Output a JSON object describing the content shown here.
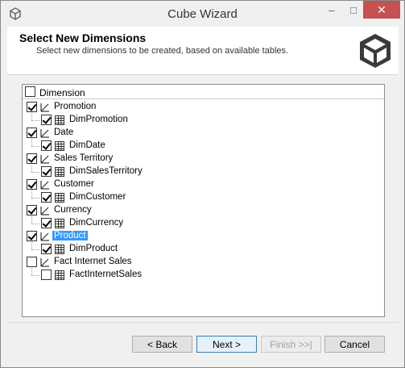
{
  "window": {
    "title": "Cube Wizard",
    "minimize_glyph": "–",
    "maximize_glyph": "□",
    "close_glyph": "✕"
  },
  "header": {
    "title": "Select New Dimensions",
    "subtitle": "Select new dimensions to be created, based on available tables."
  },
  "tree": {
    "column_header": "Dimension",
    "header_checked": false,
    "nodes": [
      {
        "dimension": "Promotion",
        "dimension_checked": true,
        "table": "DimPromotion",
        "table_checked": true,
        "selected": false
      },
      {
        "dimension": "Date",
        "dimension_checked": true,
        "table": "DimDate",
        "table_checked": true,
        "selected": false
      },
      {
        "dimension": "Sales Territory",
        "dimension_checked": true,
        "table": "DimSalesTerritory",
        "table_checked": true,
        "selected": false
      },
      {
        "dimension": "Customer",
        "dimension_checked": true,
        "table": "DimCustomer",
        "table_checked": true,
        "selected": false
      },
      {
        "dimension": "Currency",
        "dimension_checked": true,
        "table": "DimCurrency",
        "table_checked": true,
        "selected": false
      },
      {
        "dimension": "Product",
        "dimension_checked": true,
        "table": "DimProduct",
        "table_checked": true,
        "selected": true
      },
      {
        "dimension": "Fact Internet Sales",
        "dimension_checked": false,
        "table": "FactInternetSales",
        "table_checked": false,
        "selected": false
      }
    ]
  },
  "buttons": {
    "back": "< Back",
    "next": "Next >",
    "finish": "Finish >>|",
    "cancel": "Cancel"
  },
  "colors": {
    "selection": "#3399ff",
    "close_button": "#c75050"
  },
  "icons": [
    "app-cube-icon",
    "cube-logo-icon",
    "dimension-icon",
    "table-icon"
  ]
}
